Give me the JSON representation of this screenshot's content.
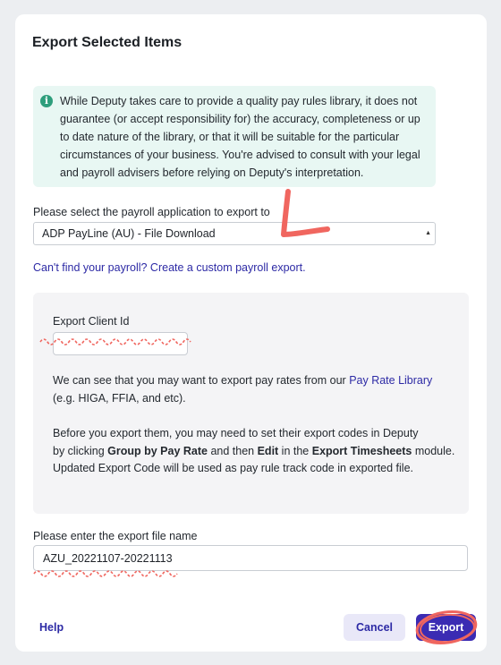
{
  "dialog": {
    "title": "Export Selected Items",
    "info": {
      "icon": "info-icon",
      "text": "While Deputy takes care to provide a quality pay rules library, it does not guarantee (or accept responsibility for) the accuracy, completeness or up to date nature of the library, or that it will be suitable for the particular circumstances of your business. You're advised to consult with your legal and payroll advisers before relying on Deputy's interpretation."
    },
    "payroll": {
      "label": "Please select the payroll application to export to",
      "selected": "ADP PayLine (AU) - File Download"
    },
    "custom_link": "Can't find your payroll? Create a custom payroll export.",
    "panel": {
      "client_id_label": "Export Client Id",
      "client_id_value": "",
      "rates_text_before": "We can see that you may want to export pay rates from our ",
      "rates_link": "Pay Rate Library",
      "rates_text_after": "(e.g. HIGA, FFIA, and etc).",
      "line1": "Before you export them, you may need to set their export codes in Deputy",
      "line2_a": "by clicking ",
      "line2_b": "Group by Pay Rate",
      "line2_c": " and then ",
      "line2_d": "Edit",
      "line2_e": " in the ",
      "line2_f": "Export Timesheets",
      "line2_g": " module.",
      "line3": "Updated Export Code will be used as pay rule track code in exported file."
    },
    "file_name": {
      "label": "Please enter the export file name",
      "value": "AZU_20221107-20221113"
    },
    "footer": {
      "help": "Help",
      "cancel": "Cancel",
      "export": "Export"
    }
  },
  "colors": {
    "accent": "#3b2bb3",
    "link": "#2d2aa5",
    "info_bg": "#e8f7f3",
    "annotation": "#f0665f"
  }
}
